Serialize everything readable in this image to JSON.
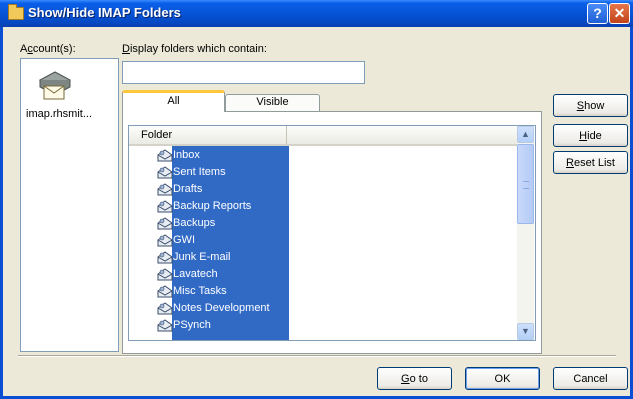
{
  "window": {
    "title": "Show/Hide IMAP Folders"
  },
  "accounts": {
    "label_pre": "A",
    "label_ul": "c",
    "label_post": "count(s):",
    "items": [
      {
        "label": "imap.rhsmit...",
        "icon": "mail-account-icon"
      }
    ]
  },
  "filter": {
    "label_ul": "D",
    "label_post": "isplay folders which contain:",
    "value": ""
  },
  "tabs": [
    {
      "label": "All",
      "active": true
    },
    {
      "label": "Visible",
      "active": false
    }
  ],
  "folder_list": {
    "column_header": "Folder",
    "folders": [
      {
        "name": "Inbox",
        "icon": "imap-inbox-icon"
      },
      {
        "name": "Sent Items",
        "icon": "imap-sent-icon"
      },
      {
        "name": "Drafts",
        "icon": "imap-drafts-icon"
      },
      {
        "name": "Backup Reports",
        "icon": "imap-folder-icon"
      },
      {
        "name": "Backups",
        "icon": "imap-folder-icon"
      },
      {
        "name": "GWI",
        "icon": "imap-folder-icon"
      },
      {
        "name": "Junk E-mail",
        "icon": "imap-folder-icon"
      },
      {
        "name": "Lavatech",
        "icon": "imap-folder-icon"
      },
      {
        "name": "Misc Tasks",
        "icon": "imap-folder-icon"
      },
      {
        "name": "Notes Development",
        "icon": "imap-folder-icon"
      },
      {
        "name": "PSynch",
        "icon": "imap-folder-icon"
      }
    ]
  },
  "side_buttons": {
    "show": {
      "ul": "S",
      "rest": "how"
    },
    "hide": {
      "ul": "H",
      "rest": "ide"
    },
    "reset": {
      "ul": "R",
      "rest": "eset List"
    }
  },
  "footer": {
    "goto": {
      "ul": "G",
      "rest": "o to"
    },
    "ok": "OK",
    "cancel": "Cancel"
  },
  "colors": {
    "titlebar": "#0653d6",
    "selection": "#316ac5",
    "dialog_bg": "#ece9d8",
    "tab_highlight": "#ffc83c"
  }
}
